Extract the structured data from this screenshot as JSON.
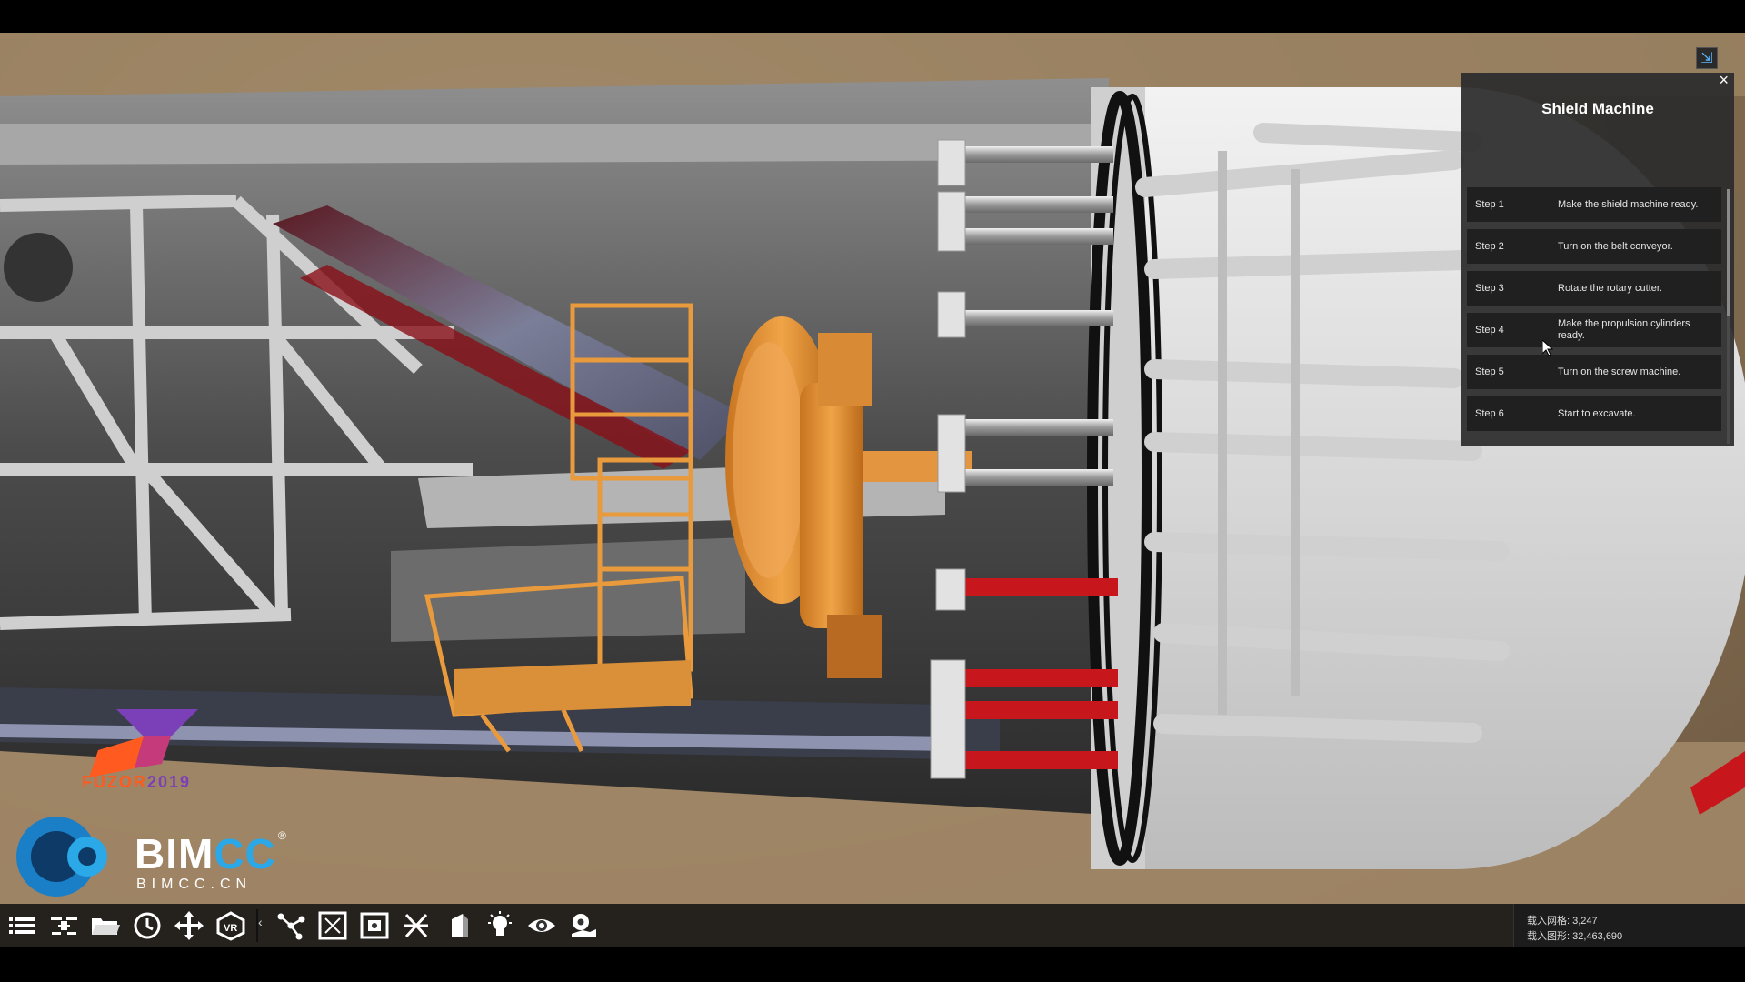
{
  "panel": {
    "title": "Shield Machine",
    "close": "×",
    "steps": [
      {
        "label": "Step 1",
        "text": "Make the shield machine ready."
      },
      {
        "label": "Step 2",
        "text": "Turn on the belt conveyor."
      },
      {
        "label": "Step 3",
        "text": "Rotate the rotary cutter."
      },
      {
        "label": "Step 4",
        "text": "Make the propulsion cylinders ready."
      },
      {
        "label": "Step 5",
        "text": "Turn on the screw machine."
      },
      {
        "label": "Step 6",
        "text": "Start to excavate."
      }
    ]
  },
  "logos": {
    "fuzor_part1": "FUZOR",
    "fuzor_part2": "2019",
    "bimcc_main": "BIM",
    "bimcc_cc": "CC",
    "bimcc_reg": "®",
    "bimcc_sub": "BIMCC.CN"
  },
  "toolbar": {
    "tools": [
      {
        "name": "menu-list-icon"
      },
      {
        "name": "drone-icon"
      },
      {
        "name": "open-folder-icon"
      },
      {
        "name": "clock-icon"
      },
      {
        "name": "move-arrows-icon"
      },
      {
        "name": "vr-icon"
      },
      {
        "name": "network-nodes-icon"
      },
      {
        "name": "fit-view-icon"
      },
      {
        "name": "screenshot-icon"
      },
      {
        "name": "section-cut-icon"
      },
      {
        "name": "shading-icon"
      },
      {
        "name": "light-bulb-icon"
      },
      {
        "name": "eye-icon"
      },
      {
        "name": "hand-settings-icon"
      }
    ],
    "collapse": "‹"
  },
  "status": {
    "line1": "载入网格: 3,247",
    "line2": "载入图形: 32,463,690"
  },
  "colors": {
    "panel_bg": "#2c2c2c",
    "step_bg": "#202020",
    "accent_orange": "#e89a3c",
    "accent_red": "#c8161d",
    "bimcc_blue": "#2aa8e8"
  }
}
